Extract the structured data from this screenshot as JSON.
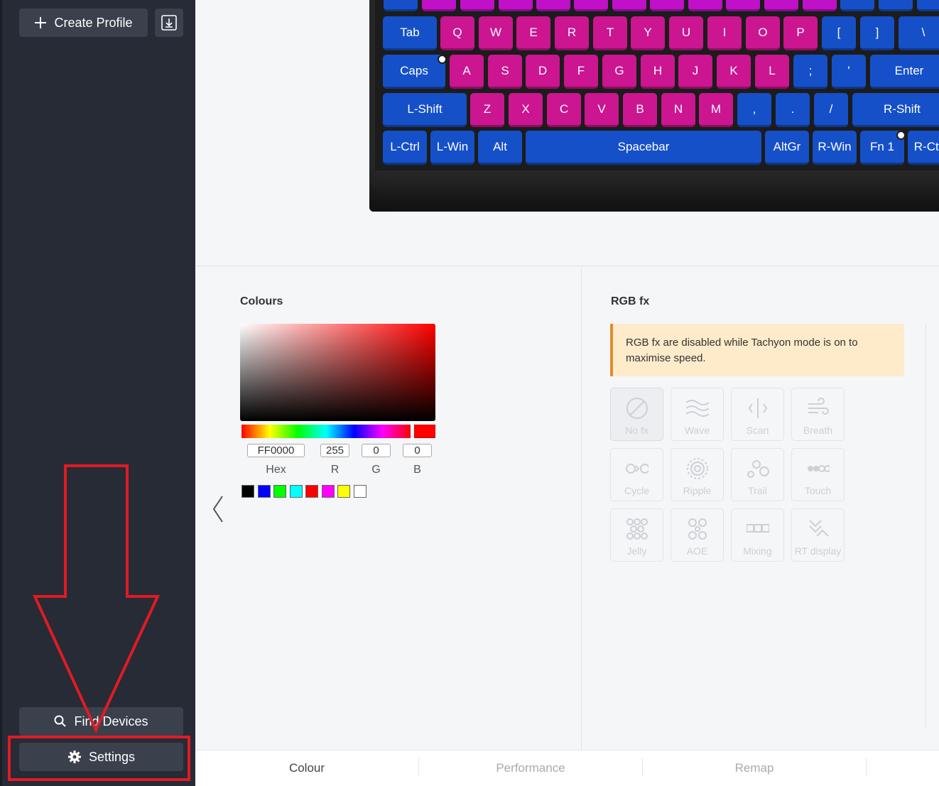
{
  "sidebar": {
    "create_profile_label": "Create Profile",
    "find_devices_label": "Find Devices",
    "settings_label": "Settings"
  },
  "keyboard": {
    "row0_colors": [
      "blue",
      "mag",
      "mag",
      "mag",
      "mag",
      "mag",
      "mag",
      "mag",
      "mag",
      "mag",
      "mag",
      "mag",
      "blue",
      "blue",
      "blue"
    ],
    "row1": [
      {
        "label": "Tab",
        "color": "blue"
      },
      {
        "label": "Q",
        "color": "pink"
      },
      {
        "label": "W",
        "color": "pink"
      },
      {
        "label": "E",
        "color": "pink"
      },
      {
        "label": "R",
        "color": "pink"
      },
      {
        "label": "T",
        "color": "pink"
      },
      {
        "label": "Y",
        "color": "pink"
      },
      {
        "label": "U",
        "color": "pink"
      },
      {
        "label": "I",
        "color": "pink"
      },
      {
        "label": "O",
        "color": "pink"
      },
      {
        "label": "P",
        "color": "pink"
      },
      {
        "label": "[",
        "color": "blue"
      },
      {
        "label": "]",
        "color": "blue"
      },
      {
        "label": "\\",
        "color": "blue"
      }
    ],
    "row2": [
      {
        "label": "Caps",
        "color": "blue",
        "dot": true
      },
      {
        "label": "A",
        "color": "pink"
      },
      {
        "label": "S",
        "color": "pink"
      },
      {
        "label": "D",
        "color": "pink"
      },
      {
        "label": "F",
        "color": "pink"
      },
      {
        "label": "G",
        "color": "pink"
      },
      {
        "label": "H",
        "color": "pink"
      },
      {
        "label": "J",
        "color": "pink"
      },
      {
        "label": "K",
        "color": "pink"
      },
      {
        "label": "L",
        "color": "pink"
      },
      {
        "label": ";",
        "color": "blue"
      },
      {
        "label": "'",
        "color": "blue"
      },
      {
        "label": "Enter",
        "color": "blue"
      }
    ],
    "row3": [
      {
        "label": "L-Shift",
        "color": "blue"
      },
      {
        "label": "Z",
        "color": "pink"
      },
      {
        "label": "X",
        "color": "pink"
      },
      {
        "label": "C",
        "color": "pink"
      },
      {
        "label": "V",
        "color": "pink"
      },
      {
        "label": "B",
        "color": "pink"
      },
      {
        "label": "N",
        "color": "pink"
      },
      {
        "label": "M",
        "color": "pink"
      },
      {
        "label": ",",
        "color": "blue"
      },
      {
        "label": ".",
        "color": "blue"
      },
      {
        "label": "/",
        "color": "blue"
      },
      {
        "label": "R-Shift",
        "color": "blue"
      }
    ],
    "row4": [
      {
        "label": "L-Ctrl",
        "color": "blue"
      },
      {
        "label": "L-Win",
        "color": "blue"
      },
      {
        "label": "Alt",
        "color": "blue"
      },
      {
        "label": "Spacebar",
        "color": "blue"
      },
      {
        "label": "AltGr",
        "color": "blue"
      },
      {
        "label": "R-Win",
        "color": "blue"
      },
      {
        "label": "Fn 1",
        "color": "blue",
        "dot": true
      },
      {
        "label": "R-Ctrl",
        "color": "blue"
      }
    ]
  },
  "colours": {
    "title": "Colours",
    "hex": "FF0000",
    "r": "255",
    "g": "0",
    "b": "0",
    "hex_label": "Hex",
    "r_label": "R",
    "g_label": "G",
    "b_label": "B",
    "swatches": [
      "#000000",
      "#0000ff",
      "#00ff00",
      "#00ffff",
      "#ff0000",
      "#ff00ff",
      "#ffff00",
      "#ffffff"
    ]
  },
  "rgbfx": {
    "title": "RGB fx",
    "warning": "RGB fx are disabled while Tachyon mode is on to maximise speed.",
    "effects": [
      {
        "label": "No fx",
        "icon": "no-fx-icon",
        "selected": true
      },
      {
        "label": "Wave",
        "icon": "wave-icon"
      },
      {
        "label": "Scan",
        "icon": "scan-icon"
      },
      {
        "label": "Breath",
        "icon": "breath-icon"
      },
      {
        "label": "Cycle",
        "icon": "cycle-icon"
      },
      {
        "label": "Ripple",
        "icon": "ripple-icon"
      },
      {
        "label": "Trail",
        "icon": "trail-icon"
      },
      {
        "label": "Touch",
        "icon": "touch-icon"
      },
      {
        "label": "Jelly",
        "icon": "jelly-icon"
      },
      {
        "label": "AOE",
        "icon": "aoe-icon"
      },
      {
        "label": "Mixing",
        "icon": "mixing-icon"
      },
      {
        "label": "RT display",
        "icon": "rt-display-icon"
      }
    ]
  },
  "tabs": [
    {
      "label": "Colour",
      "active": true
    },
    {
      "label": "Performance"
    },
    {
      "label": "Remap"
    }
  ],
  "annotation_color": "#e01b24"
}
